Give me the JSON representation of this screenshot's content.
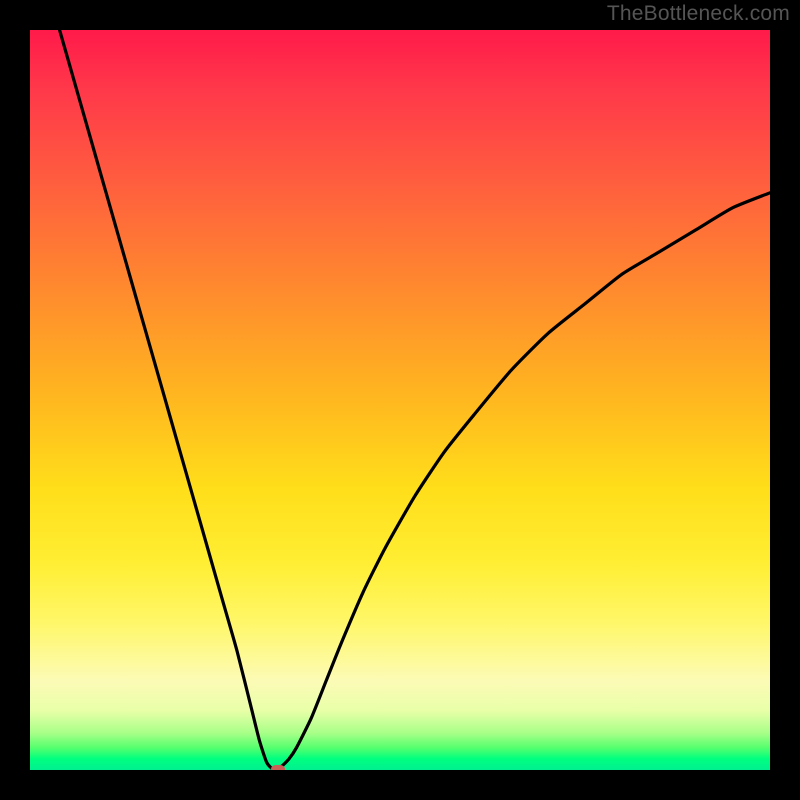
{
  "watermark": "TheBottleneck.com",
  "chart_data": {
    "type": "line",
    "title": "",
    "xlabel": "",
    "ylabel": "",
    "xlim": [
      0,
      100
    ],
    "ylim": [
      0,
      100
    ],
    "series": [
      {
        "name": "bottleneck-curve",
        "x": [
          4,
          6,
          8,
          10,
          12,
          14,
          16,
          18,
          20,
          22,
          24,
          26,
          28,
          30,
          31,
          32,
          33,
          34,
          35,
          36,
          38,
          40,
          42,
          45,
          48,
          52,
          56,
          60,
          65,
          70,
          75,
          80,
          85,
          90,
          95,
          100
        ],
        "values": [
          100,
          93,
          86,
          79,
          72,
          65,
          58,
          51,
          44,
          37,
          30,
          23,
          16,
          8,
          4,
          1,
          0,
          0.5,
          1.5,
          3,
          7,
          12,
          17,
          24,
          30,
          37,
          43,
          48,
          54,
          59,
          63,
          67,
          70,
          73,
          76,
          78
        ]
      }
    ],
    "marker": {
      "x": 33.5,
      "y": 0
    },
    "gradient_stops": [
      {
        "pos": 0,
        "color": "#ff1a4a"
      },
      {
        "pos": 0.35,
        "color": "#ff8a2e"
      },
      {
        "pos": 0.62,
        "color": "#ffde1a"
      },
      {
        "pos": 0.88,
        "color": "#fcfbb6"
      },
      {
        "pos": 0.97,
        "color": "#55ff6e"
      },
      {
        "pos": 1.0,
        "color": "#00f090"
      }
    ]
  }
}
